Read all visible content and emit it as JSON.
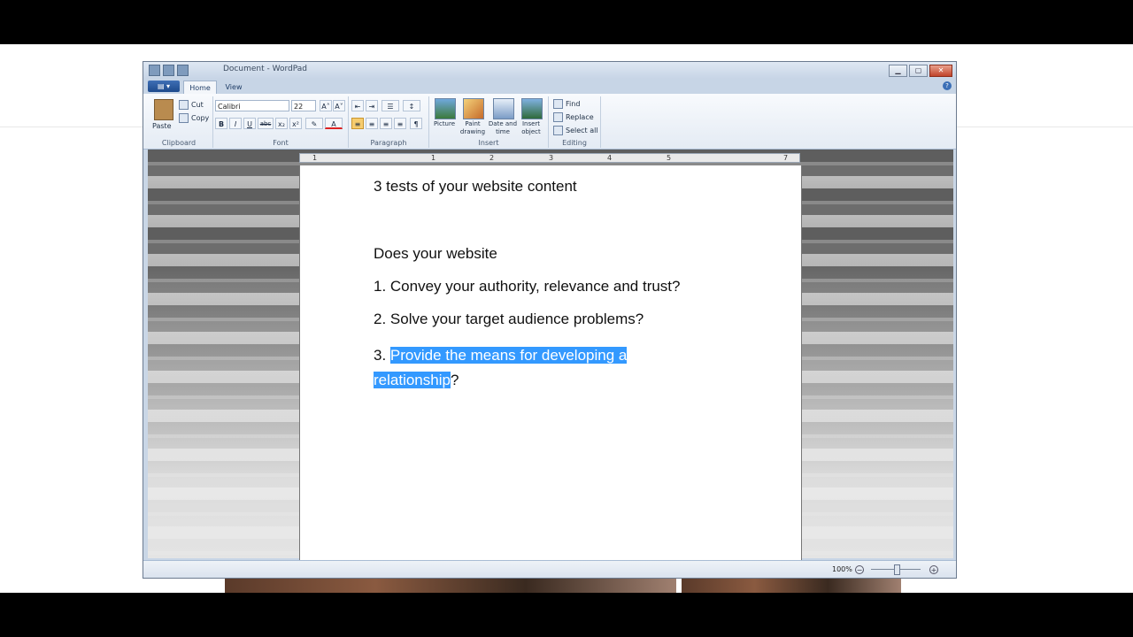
{
  "window": {
    "title": "Document - WordPad"
  },
  "tabs": {
    "home": "Home",
    "view": "View",
    "app_menu": "▤ ▾"
  },
  "clipboard": {
    "paste": "Paste",
    "cut": "Cut",
    "copy": "Copy",
    "label": "Clipboard"
  },
  "font": {
    "family": "Calibri",
    "size": "22",
    "label": "Font",
    "bold": "B",
    "italic": "I",
    "underline": "U",
    "strike": "abc",
    "subscript": "x₂",
    "superscript": "x²",
    "grow": "A˄",
    "shrink": "A˅",
    "highlight": "✎",
    "color": "A"
  },
  "paragraph": {
    "label": "Paragraph"
  },
  "insert": {
    "picture": "Picture",
    "paint": "Paint drawing",
    "datetime": "Date and time",
    "object": "Insert object",
    "label": "Insert"
  },
  "editing": {
    "find": "Find",
    "replace": "Replace",
    "select_all": "Select all",
    "label": "Editing"
  },
  "ruler": {
    "marks": [
      "1",
      "1",
      "2",
      "3",
      "4",
      "5",
      "7"
    ]
  },
  "document": {
    "heading": "3 tests of your website content",
    "intro": "Does your website",
    "item1": "1. Convey your authority, relevance and trust?",
    "item2": "2. Solve your target audience problems?",
    "item3_prefix": "3. ",
    "item3_selected": "Provide the means for developing a relationship",
    "item3_suffix": "?"
  },
  "status": {
    "zoom": "100%",
    "zoom_out": "−",
    "zoom_in": "+"
  }
}
